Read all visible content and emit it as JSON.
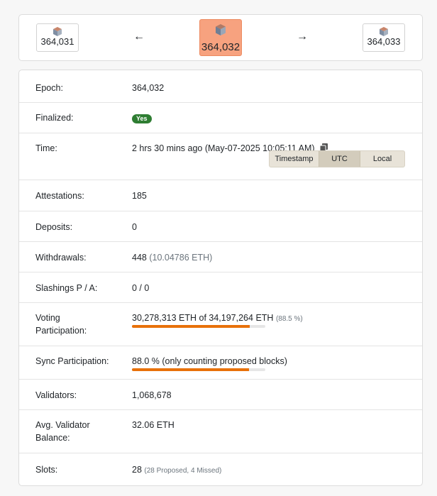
{
  "nav": {
    "prev_epoch": "364,031",
    "current_epoch": "364,032",
    "next_epoch": "364,033",
    "prev_arrow": "←",
    "next_arrow": "→"
  },
  "details": {
    "epoch": {
      "label": "Epoch:",
      "value": "364,032"
    },
    "finalized": {
      "label": "Finalized:",
      "badge": "Yes"
    },
    "time": {
      "label": "Time:",
      "value": "2 hrs 30 mins ago (May-07-2025 10:05:11 AM)",
      "toggle": {
        "timestamp": "Timestamp",
        "utc": "UTC",
        "local": "Local",
        "selected": "UTC"
      }
    },
    "attestations": {
      "label": "Attestations:",
      "value": "185"
    },
    "deposits": {
      "label": "Deposits:",
      "value": "0"
    },
    "withdrawals": {
      "label": "Withdrawals:",
      "value": "448",
      "extra": "(10.04786 ETH)"
    },
    "slashings": {
      "label": "Slashings P / A:",
      "value": "0 / 0"
    },
    "voting": {
      "label_line1": "Voting",
      "label_line2": "Participation:",
      "value": "30,278,313 ETH of 34,197,264 ETH",
      "percent": "(88.5 %)",
      "progress": 88.5
    },
    "sync": {
      "label": "Sync Participation:",
      "value": "88.0 % (only counting proposed blocks)",
      "progress": 88.0
    },
    "validators": {
      "label": "Validators:",
      "value": "1,068,678"
    },
    "avg_balance": {
      "label_line1": "Avg. Validator",
      "label_line2": "Balance:",
      "value": "32.06 ETH"
    },
    "slots": {
      "label": "Slots:",
      "value": "28",
      "extra": "(28 Proposed, 4 Missed)"
    }
  },
  "colors": {
    "accent": "#e8710a",
    "current_tile": "#f7a27f",
    "finalized_badge": "#2e7d32"
  }
}
